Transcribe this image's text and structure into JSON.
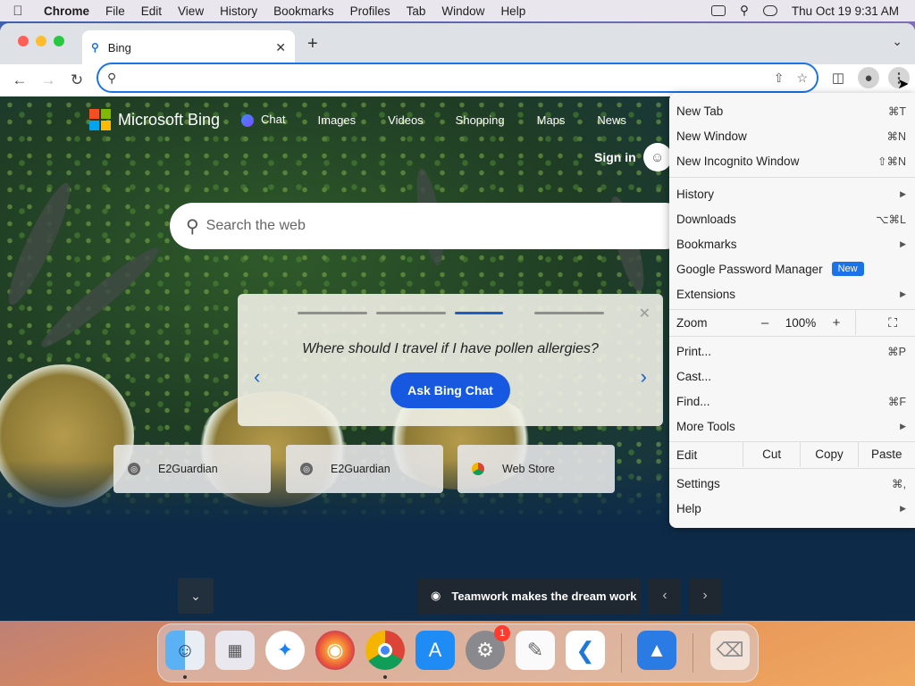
{
  "menubar": {
    "apple": "",
    "items": [
      "Chrome",
      "File",
      "Edit",
      "View",
      "History",
      "Bookmarks",
      "Profiles",
      "Tab",
      "Window",
      "Help"
    ],
    "datetime": "Thu Oct 19  9:31 AM"
  },
  "tab": {
    "title": "Bing",
    "favicon": "bing-search-icon"
  },
  "omnibox": {
    "value": "",
    "placeholder": ""
  },
  "bing": {
    "brand": "Microsoft Bing",
    "nav": [
      "Chat",
      "Images",
      "Videos",
      "Shopping",
      "Maps",
      "News"
    ],
    "signin": "Sign in",
    "search_placeholder": "Search the web",
    "promo_question": "Where should I travel if I have pollen allergies?",
    "promo_button": "Ask Bing Chat",
    "promo_progress": [
      0,
      0,
      1,
      0
    ],
    "tiles": [
      "E2Guardian",
      "E2Guardian",
      "Web Store"
    ],
    "caption": "Teamwork makes the dream work"
  },
  "menu": {
    "new_tab": {
      "label": "New Tab",
      "shortcut": "⌘T"
    },
    "new_window": {
      "label": "New Window",
      "shortcut": "⌘N"
    },
    "new_incognito": {
      "label": "New Incognito Window",
      "shortcut": "⇧⌘N"
    },
    "history": {
      "label": "History"
    },
    "downloads": {
      "label": "Downloads",
      "shortcut": "⌥⌘L"
    },
    "bookmarks": {
      "label": "Bookmarks"
    },
    "password_manager": {
      "label": "Google Password Manager",
      "badge": "New"
    },
    "extensions": {
      "label": "Extensions"
    },
    "zoom": {
      "label": "Zoom",
      "minus": "–",
      "value": "100%",
      "plus": "+"
    },
    "print": {
      "label": "Print...",
      "shortcut": "⌘P"
    },
    "cast": {
      "label": "Cast..."
    },
    "find": {
      "label": "Find...",
      "shortcut": "⌘F"
    },
    "more_tools": {
      "label": "More Tools"
    },
    "edit": {
      "label": "Edit",
      "cut": "Cut",
      "copy": "Copy",
      "paste": "Paste"
    },
    "settings": {
      "label": "Settings",
      "shortcut": "⌘,"
    },
    "help": {
      "label": "Help"
    }
  },
  "dock": {
    "apps": [
      "finder-icon",
      "launchpad-icon",
      "safari-icon",
      "firefox-icon",
      "chrome-icon",
      "app-store-icon",
      "system-settings-icon",
      "textedit-icon",
      "vscode-icon",
      "keynote-icon",
      "trash-icon"
    ],
    "settings_badge": "1"
  }
}
